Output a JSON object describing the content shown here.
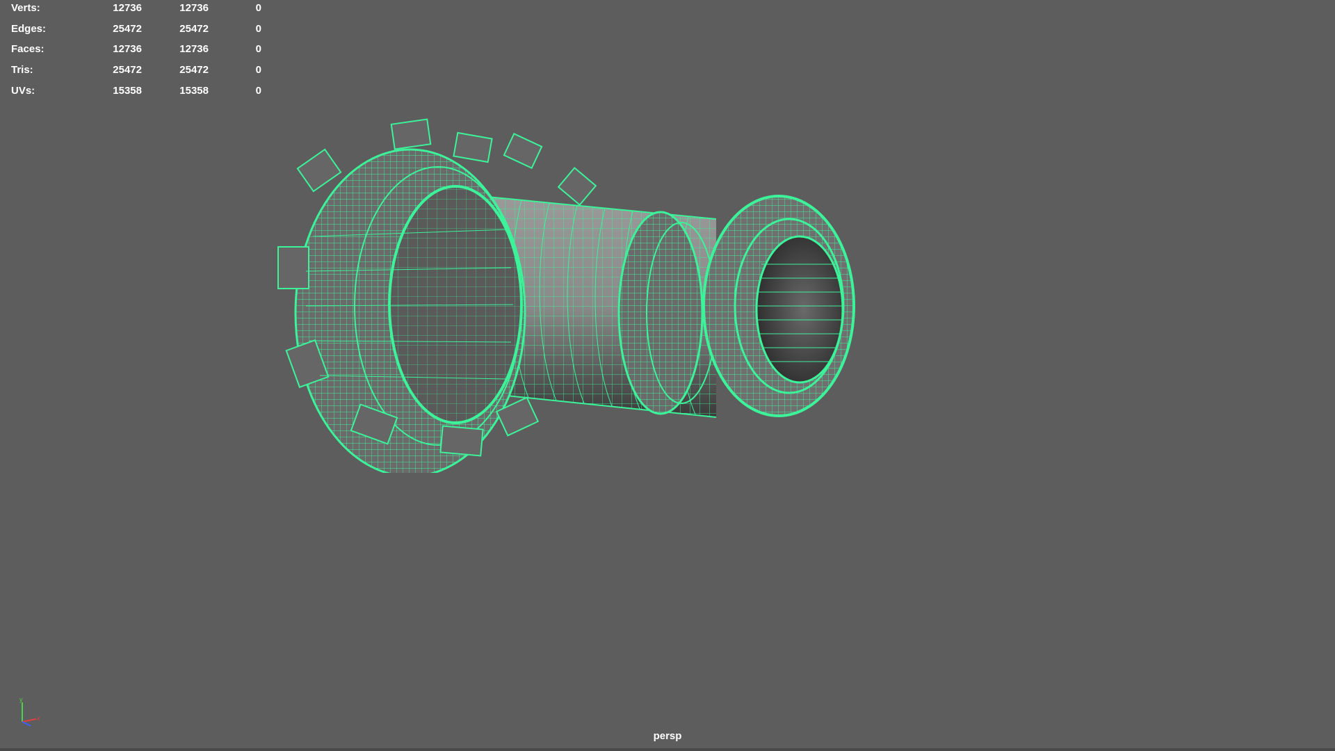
{
  "hud": {
    "rows": [
      {
        "label": "Verts:",
        "c1": "12736",
        "c2": "12736",
        "c3": "0"
      },
      {
        "label": "Edges:",
        "c1": "25472",
        "c2": "25472",
        "c3": "0"
      },
      {
        "label": "Faces:",
        "c1": "12736",
        "c2": "12736",
        "c3": "0"
      },
      {
        "label": "Tris:",
        "c1": "25472",
        "c2": "25472",
        "c3": "0"
      },
      {
        "label": "UVs:",
        "c1": "15358",
        "c2": "15358",
        "c3": "0"
      }
    ]
  },
  "viewport": {
    "camera_label": "persp",
    "background_color": "#5d5d5d",
    "wire_color": "#3cf39a"
  },
  "axis_gizmo": {
    "y_color": "#4cd24c",
    "x_color": "#e04040",
    "z_color": "#4060ff"
  },
  "icons": [
    "axis-gizmo-icon",
    "wireframe-model"
  ]
}
